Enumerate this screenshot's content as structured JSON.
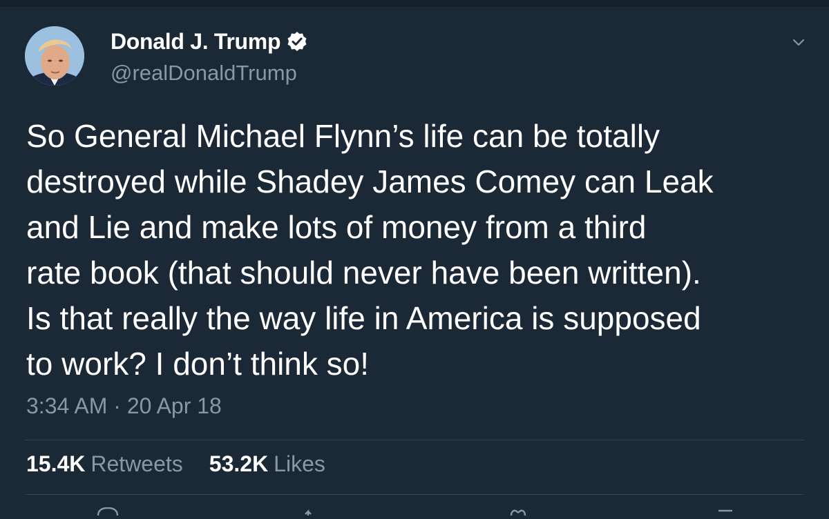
{
  "user": {
    "display_name": "Donald J. Trump",
    "handle": "@realDonaldTrump",
    "verified": true
  },
  "tweet": {
    "lines": [
      "So General Michael Flynn’s life can be totally",
      "destroyed while Shadey James Comey can Leak",
      "and Lie and make lots of money from a third",
      "rate book (that should never have been written).",
      "Is that really the way life in America is supposed",
      "to work? I don’t think so!"
    ],
    "timestamp": "3:34 AM · 20 Apr 18"
  },
  "stats": {
    "retweets_count": "15.4K",
    "retweets_label": "Retweets",
    "likes_count": "53.2K",
    "likes_label": "Likes"
  },
  "icons": {
    "verified": "verified-badge-icon",
    "menu": "chevron-down-icon",
    "reply": "reply-icon",
    "retweet": "retweet-icon",
    "like": "heart-icon",
    "share": "share-icon"
  },
  "colors": {
    "background": "#1b2836",
    "text_primary": "#ffffff",
    "text_secondary": "#8899a6",
    "divider": "#38444d"
  }
}
